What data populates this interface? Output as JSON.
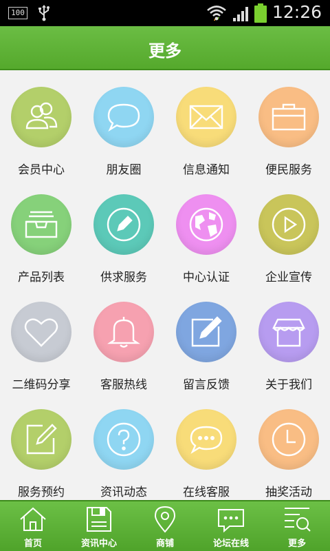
{
  "status_bar": {
    "battery_percent": "100",
    "time": "12:26"
  },
  "header": {
    "title": "更多"
  },
  "grid": {
    "items": [
      {
        "label": "会员中心",
        "icon": "users-icon",
        "color": "#b3cf6a"
      },
      {
        "label": "朋友圈",
        "icon": "chat-bubble-icon",
        "color": "#8fd6f2"
      },
      {
        "label": "信息通知",
        "icon": "envelope-icon",
        "color": "#f8dc79"
      },
      {
        "label": "便民服务",
        "icon": "briefcase-icon",
        "color": "#f9bd84"
      },
      {
        "label": "产品列表",
        "icon": "inbox-tray-icon",
        "color": "#86d17a"
      },
      {
        "label": "供求服务",
        "icon": "pencil-circle-icon",
        "color": "#5cc9b8"
      },
      {
        "label": "中心认证",
        "icon": "globe-icon",
        "color": "#ee8ff0"
      },
      {
        "label": "企业宣传",
        "icon": "play-circle-icon",
        "color": "#c9c55a"
      },
      {
        "label": "二维码分享",
        "icon": "heart-icon",
        "color": "#c7cbd3"
      },
      {
        "label": "客服热线",
        "icon": "bell-icon",
        "color": "#f6a1b0"
      },
      {
        "label": "留言反馈",
        "icon": "edit-square-icon",
        "color": "#7fa6e0"
      },
      {
        "label": "关于我们",
        "icon": "shop-awning-icon",
        "color": "#b79cf0"
      },
      {
        "label": "服务预约",
        "icon": "note-edit-icon",
        "color": "#b3cf6a"
      },
      {
        "label": "资讯动态",
        "icon": "question-circle-icon",
        "color": "#8fd6f2"
      },
      {
        "label": "在线客服",
        "icon": "chat-dots-icon",
        "color": "#f8dc79"
      },
      {
        "label": "抽奖活动",
        "icon": "clock-icon",
        "color": "#f9bd84"
      }
    ]
  },
  "bottom_nav": {
    "items": [
      {
        "label": "首页",
        "icon": "home-icon"
      },
      {
        "label": "资讯中心",
        "icon": "save-icon"
      },
      {
        "label": "商铺",
        "icon": "location-pin-icon"
      },
      {
        "label": "论坛在线",
        "icon": "message-box-icon"
      },
      {
        "label": "更多",
        "icon": "more-list-icon"
      }
    ]
  }
}
